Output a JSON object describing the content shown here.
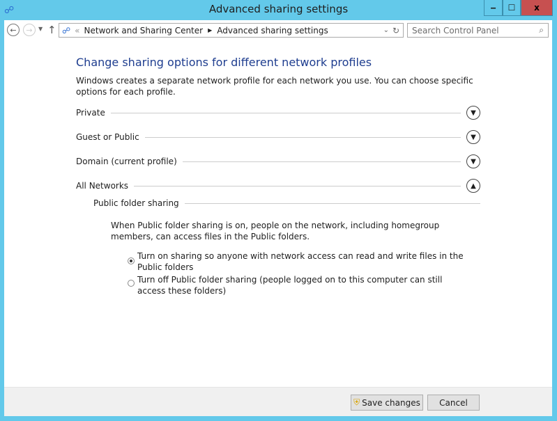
{
  "window": {
    "title": "Advanced sharing settings",
    "minimize": "‒",
    "maximize": "☐",
    "close": "x"
  },
  "nav": {
    "breadcrumb": [
      "Network and Sharing Center",
      "Advanced sharing settings"
    ],
    "search_placeholder": "Search Control Panel"
  },
  "main": {
    "heading": "Change sharing options for different network profiles",
    "intro": "Windows creates a separate network profile for each network you use. You can choose specific options for each profile.",
    "sections": [
      {
        "label": "Private",
        "expanded": false
      },
      {
        "label": "Guest or Public",
        "expanded": false
      },
      {
        "label": "Domain (current profile)",
        "expanded": false
      },
      {
        "label": "All Networks",
        "expanded": true
      }
    ],
    "subsection": "Public folder sharing",
    "description": "When Public folder sharing is on, people on the network, including homegroup members, can access files in the Public folders.",
    "options": [
      {
        "label": "Turn on sharing so anyone with network access can read and write files in the Public folders",
        "selected": true
      },
      {
        "label": "Turn off Public folder sharing (people logged on to this computer can still access these folders)",
        "selected": false
      }
    ]
  },
  "footer": {
    "save": "Save changes",
    "cancel": "Cancel"
  }
}
